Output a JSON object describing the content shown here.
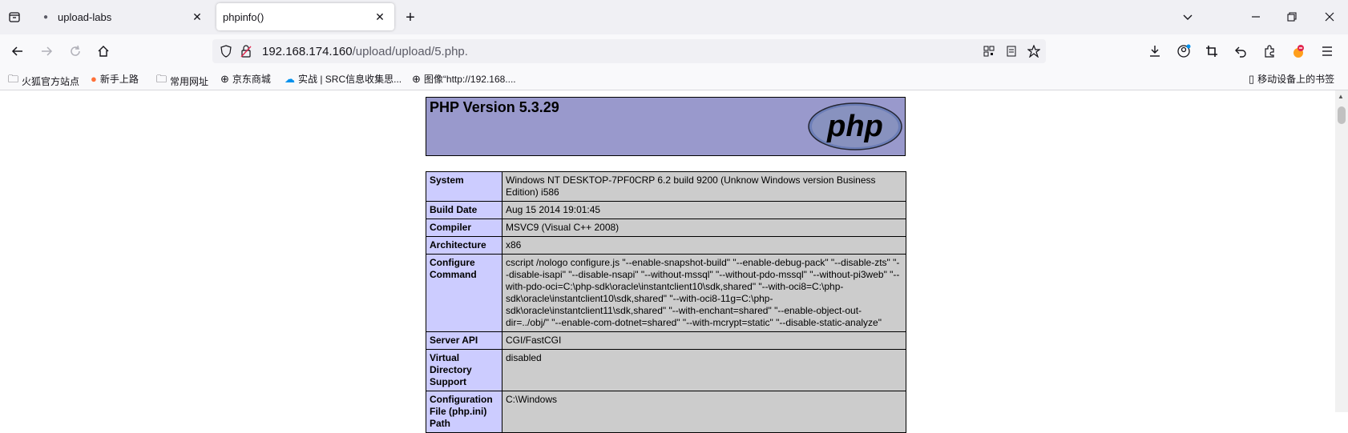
{
  "tabs": [
    {
      "label": "upload-labs",
      "active": false
    },
    {
      "label": "phpinfo()",
      "active": true
    }
  ],
  "url": {
    "host": "192.168.174.160",
    "path": "/upload/upload/5.php."
  },
  "bookmarks": [
    {
      "label": "火狐官方站点",
      "icon": "folder-icon"
    },
    {
      "label": "新手上路",
      "icon": "firefox-icon"
    },
    {
      "label": "常用网址",
      "icon": "folder-icon"
    },
    {
      "label": "京东商城",
      "icon": "globe-icon"
    },
    {
      "label": "实战 | SRC信息收集思...",
      "icon": "cloud-icon"
    },
    {
      "label": "图像“http://192.168....",
      "icon": "globe-icon"
    }
  ],
  "mobile_bookmarks": "移动设备上的书签",
  "php": {
    "version_title": "PHP Version 5.3.29",
    "logo_text": "php",
    "rows": [
      {
        "key": "System",
        "value": "Windows NT DESKTOP-7PF0CRP 6.2 build 9200 (Unknow Windows version Business Edition) i586"
      },
      {
        "key": "Build Date",
        "value": "Aug 15 2014 19:01:45"
      },
      {
        "key": "Compiler",
        "value": "MSVC9 (Visual C++ 2008)"
      },
      {
        "key": "Architecture",
        "value": "x86"
      },
      {
        "key": "Configure Command",
        "value": "cscript /nologo configure.js \"--enable-snapshot-build\" \"--enable-debug-pack\" \"--disable-zts\" \"--disable-isapi\" \"--disable-nsapi\" \"--without-mssql\" \"--without-pdo-mssql\" \"--without-pi3web\" \"--with-pdo-oci=C:\\php-sdk\\oracle\\instantclient10\\sdk,shared\" \"--with-oci8=C:\\php-sdk\\oracle\\instantclient10\\sdk,shared\" \"--with-oci8-11g=C:\\php-sdk\\oracle\\instantclient11\\sdk,shared\" \"--with-enchant=shared\" \"--enable-object-out-dir=../obj/\" \"--enable-com-dotnet=shared\" \"--with-mcrypt=static\" \"--disable-static-analyze\""
      },
      {
        "key": "Server API",
        "value": "CGI/FastCGI"
      },
      {
        "key": "Virtual Directory Support",
        "value": "disabled"
      },
      {
        "key": "Configuration File (php.ini) Path",
        "value": "C:\\Windows"
      }
    ]
  }
}
